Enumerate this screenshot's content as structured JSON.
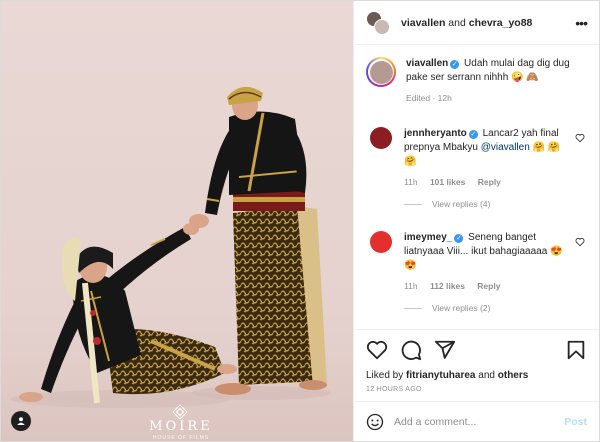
{
  "header": {
    "user1": "viavallen",
    "and": "and",
    "user2": "chevra_yo88",
    "more_icon": "more-horizontal-icon"
  },
  "caption": {
    "username": "viavallen",
    "text": "Udah mulai dag dig dug pake ser serrann nihhh 🤪 🙈",
    "meta": "Edited · 12h"
  },
  "comments": [
    {
      "username": "jennheryanto",
      "text_before": "Lancar2 yah final prepnya Mbakyu",
      "mention": "@viavallen",
      "text_after": "🤗 🤗 🤗",
      "time": "11h",
      "likes": "101 likes",
      "reply": "Reply",
      "view_replies": "View replies (4)",
      "avatar_color": "#8c1d22"
    },
    {
      "username": "imeymey_",
      "text_before": "Seneng banget liatnyaaa Viii... ikut bahagiaaaaa",
      "mention": "",
      "text_after": "😍 😍",
      "time": "11h",
      "likes": "112 likes",
      "reply": "Reply",
      "view_replies": "View replies (2)",
      "avatar_color": "#e3302f"
    }
  ],
  "actions": {
    "like_icon": "heart-icon",
    "comment_icon": "comment-icon",
    "share_icon": "share-icon",
    "save_icon": "bookmark-icon"
  },
  "likes": {
    "prefix": "Liked by",
    "user": "fitrianytuharea",
    "and": "and",
    "others": "others"
  },
  "timestamp": "12 HOURS AGO",
  "add_comment": {
    "placeholder": "Add a comment...",
    "post_label": "Post"
  },
  "watermark": {
    "brand": "MOIRE",
    "sub": "HOUSE OF FILMS"
  },
  "colors": {
    "accent": "#3897f0",
    "muted": "#8e8e8e",
    "post_disabled": "#b2dffc",
    "photo_bg": "#e7d5d2"
  }
}
